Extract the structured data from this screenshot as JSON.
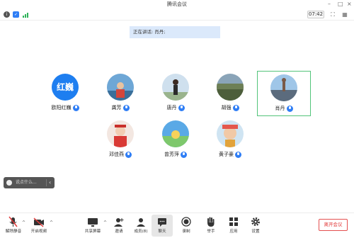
{
  "window": {
    "title": "腾讯会议"
  },
  "toolbar": {
    "time": "07:42"
  },
  "speaking": {
    "text": "正在讲话: 肖丹;"
  },
  "participants": [
    {
      "name": "欧阳红巍",
      "avatar_text": "红巍"
    },
    {
      "name": "龚芳"
    },
    {
      "name": "唐丹"
    },
    {
      "name": "胡强"
    },
    {
      "name": "肖丹",
      "active": true
    },
    {
      "name": "邓佳燕"
    },
    {
      "name": "曾芳萍"
    },
    {
      "name": "黄子豪"
    }
  ],
  "chat": {
    "placeholder": "说点什么..."
  },
  "bottom": {
    "unmute": "解除静音",
    "video": "开启视频",
    "share": "共享屏幕",
    "invite": "邀请",
    "members": "成员(8)",
    "chat": "聊天",
    "record": "录制",
    "raise_hand": "举手",
    "apps": "应用",
    "settings": "设置",
    "leave": "离开会议"
  },
  "colors": {
    "accent": "#2f7ef5",
    "active_border": "#52c47a",
    "leave": "#e23b3b"
  }
}
